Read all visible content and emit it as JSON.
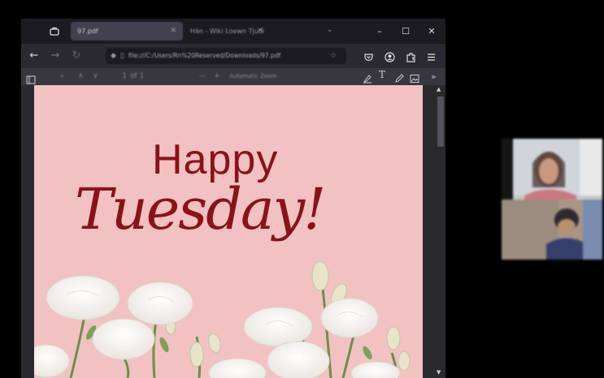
{
  "browser": {
    "tabs": [
      {
        "label": "97.pdf",
        "active": true
      },
      {
        "label": "Hán - Wiki Loewn Tjudi",
        "active": false
      }
    ],
    "url": "file:///C:/Users/Rn%20Reserved/Downloads/97.pdf",
    "window_controls": {
      "minimize": "–",
      "maximize": "☐",
      "close": "✕"
    }
  },
  "pdf_toolbar": {
    "page_number": "1",
    "page_count": "of 1",
    "zoom": "Automatic Zoom"
  },
  "document": {
    "line1": "Happy",
    "line2": "Tuesday!"
  },
  "colors": {
    "page_background": "#f2c2c2",
    "title_color": "#8b1218",
    "chrome_dark": "#1c1b22",
    "chrome_mid": "#2b2a33"
  },
  "icons": [
    "tab-list-icon",
    "back-arrow-icon",
    "forward-arrow-icon",
    "reload-icon",
    "shield-icon",
    "page-icon",
    "star-icon",
    "pocket-icon",
    "account-icon",
    "extensions-icon",
    "menu-icon",
    "sidebar-toggle-icon",
    "highlight-icon",
    "text-icon",
    "draw-icon",
    "image-icon",
    "more-tools-icon"
  ]
}
